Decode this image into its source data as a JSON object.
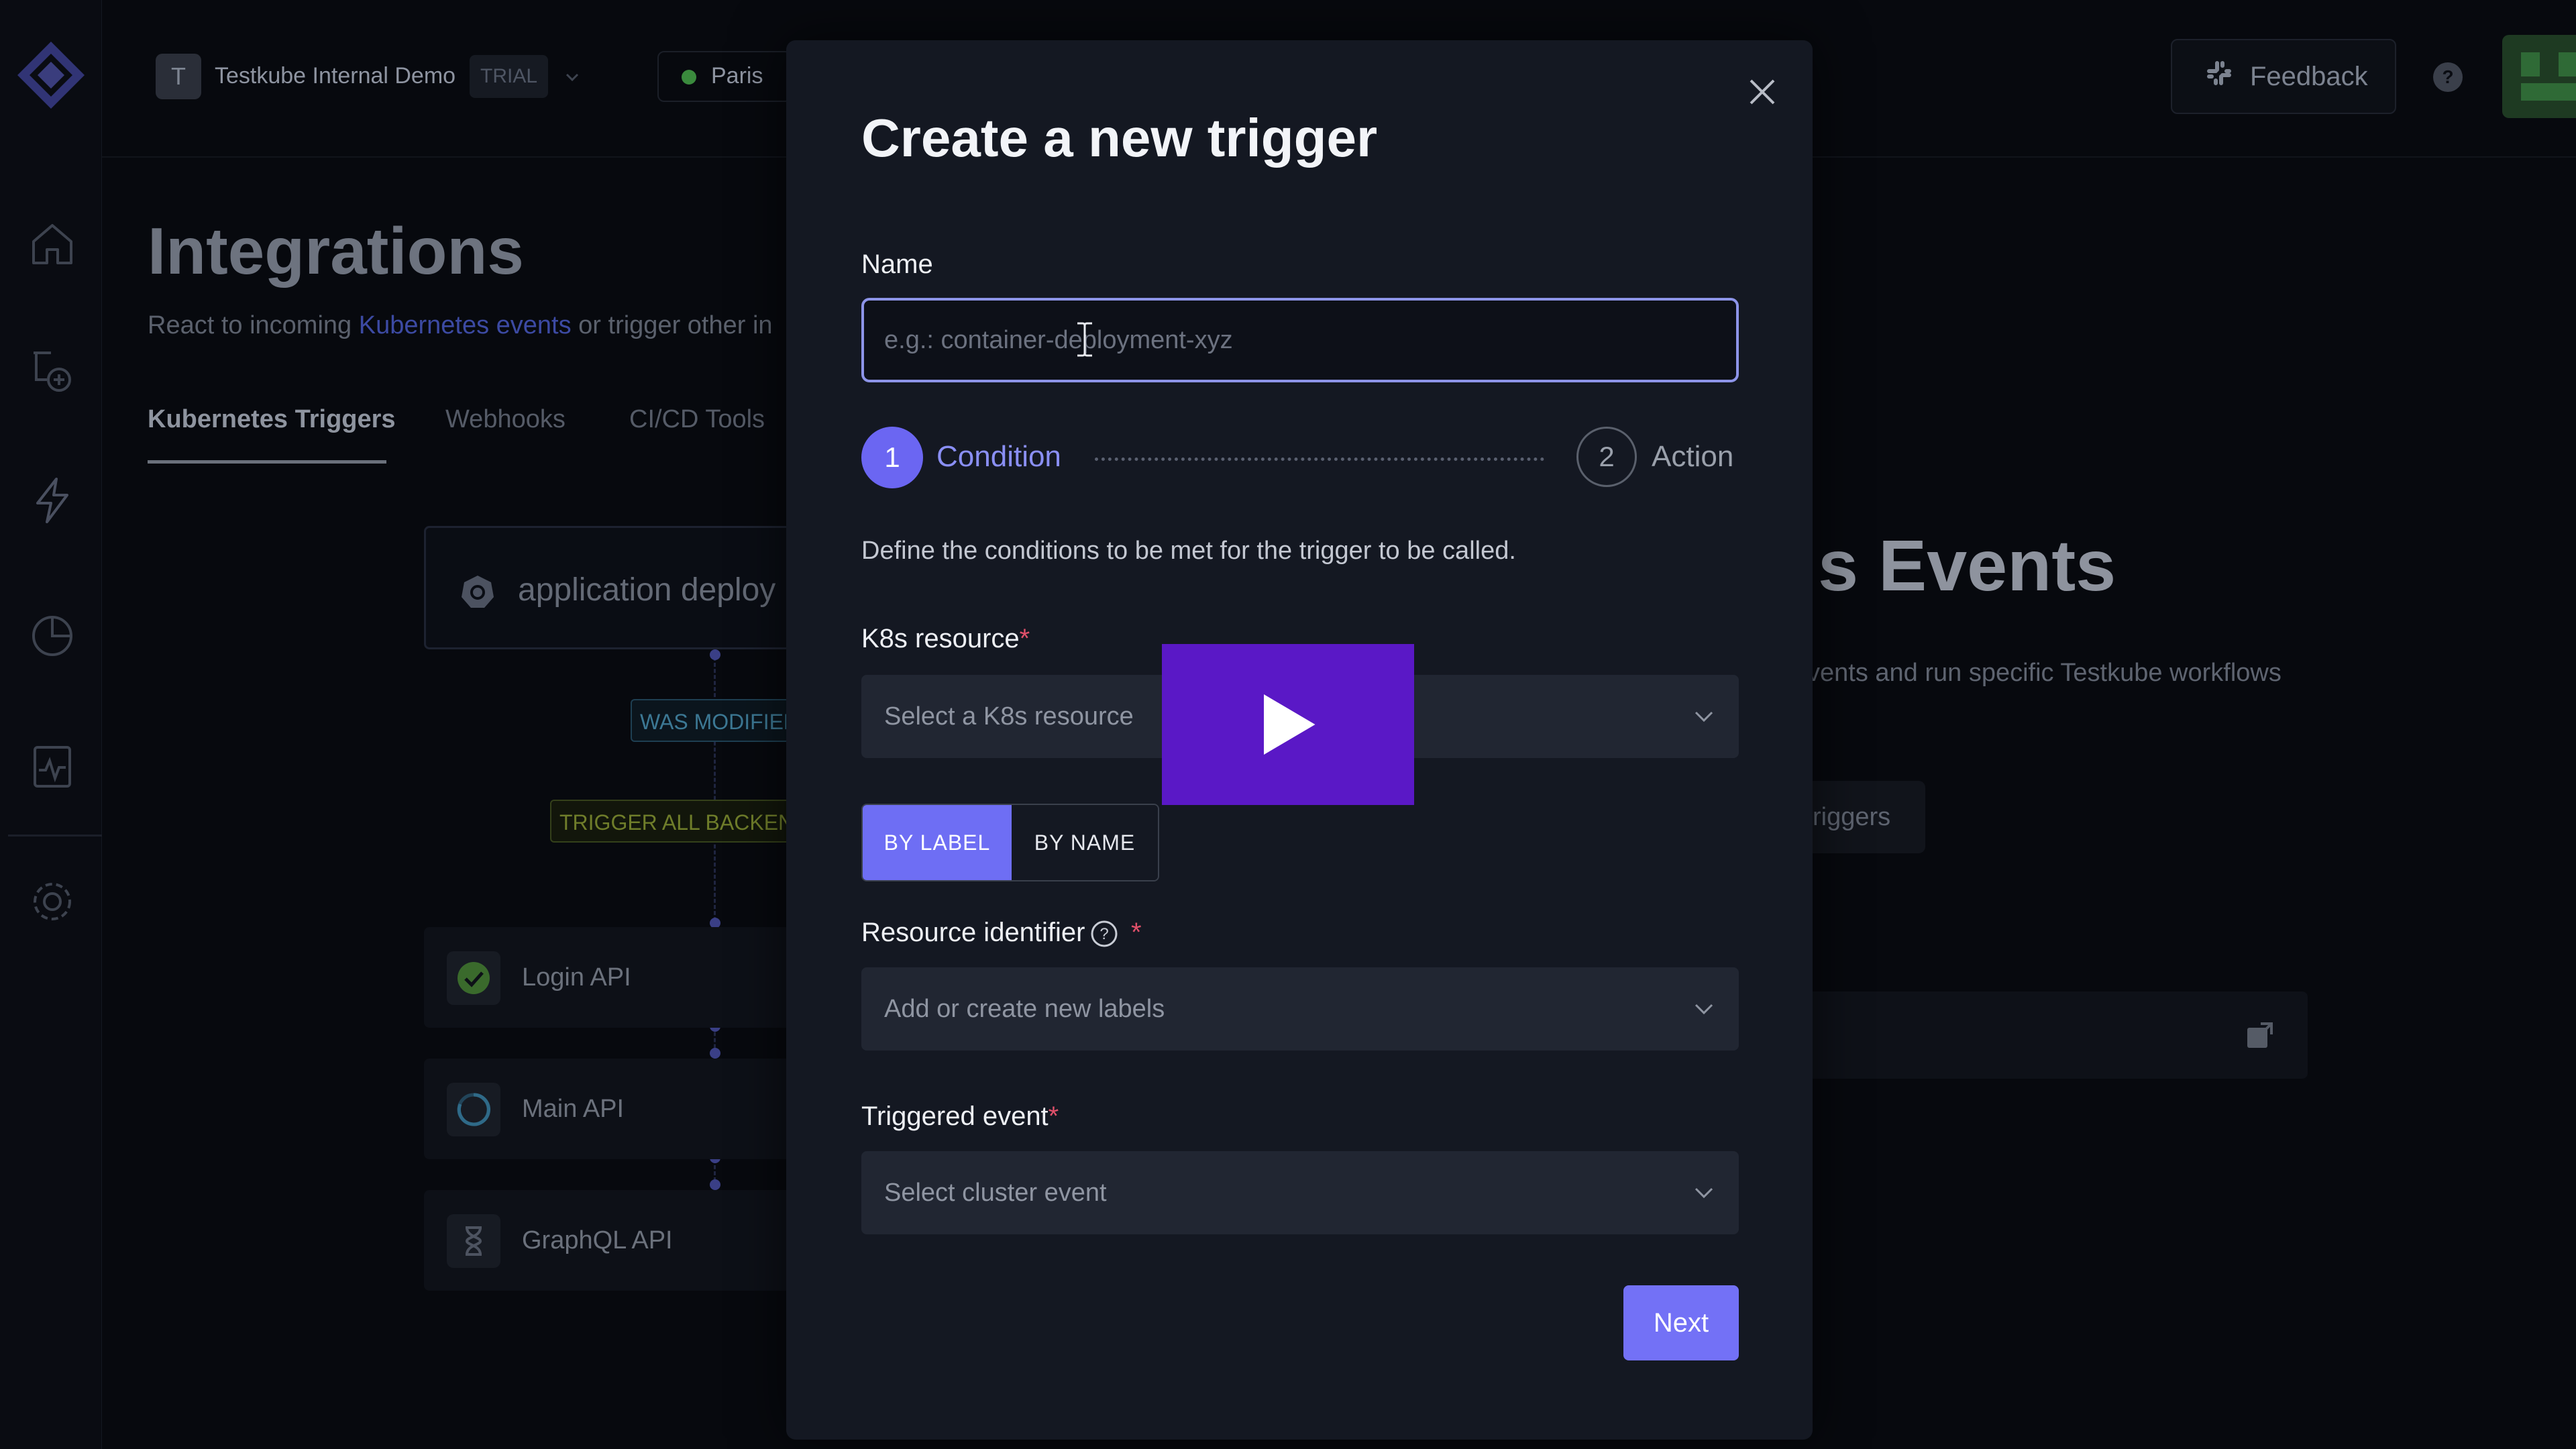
{
  "header": {
    "org_initial": "T",
    "org_name": "Testkube Internal Demo",
    "plan_badge": "TRIAL",
    "environment": "Paris",
    "feedback_label": "Feedback"
  },
  "sidebar": {
    "icons": [
      "home-icon",
      "add-workflow-icon",
      "lightning-icon",
      "analytics-icon",
      "status-icon",
      "settings-icon"
    ]
  },
  "page": {
    "title": "Integrations",
    "subtitle_prefix": "React to incoming ",
    "subtitle_link": "Kubernetes events",
    "subtitle_suffix": " or trigger other in",
    "tabs": [
      "Kubernetes Triggers",
      "Webhooks",
      "CI/CD Tools"
    ]
  },
  "trigger_flow": {
    "card_text": "application deploy",
    "condition_pill": "WAS MODIFIED",
    "action_pill": "TRIGGER ALL BACKEN",
    "apis": [
      {
        "name": "Login API",
        "status": "passed"
      },
      {
        "name": "Main API",
        "status": "running"
      },
      {
        "name": "GraphQL API",
        "status": "queued"
      }
    ]
  },
  "background_panel": {
    "title_fragment": "s Events",
    "subtitle_fragment": "vents and run specific Testkube workflows",
    "button_fragment": "riggers"
  },
  "modal": {
    "title": "Create a new trigger",
    "name_label": "Name",
    "name_placeholder": "e.g.: container-deployment-xyz",
    "name_value": "",
    "steps": [
      {
        "number": "1",
        "label": "Condition",
        "active": true
      },
      {
        "number": "2",
        "label": "Action",
        "active": false
      }
    ],
    "description": "Define the conditions to be met for the trigger to be called.",
    "k8s_resource_label": "K8s resource",
    "k8s_resource_placeholder": "Select a K8s resource",
    "mode_by_label": "BY LABEL",
    "mode_by_name": "BY NAME",
    "selected_mode": "BY LABEL",
    "resource_identifier_label": "Resource identifier",
    "resource_identifier_placeholder": "Add or create new labels",
    "triggered_event_label": "Triggered event",
    "triggered_event_placeholder": "Select cluster event",
    "required_marker": "*",
    "next_label": "Next"
  },
  "colors": {
    "accent": "#6b66f2",
    "modal_bg": "#141822",
    "page_bg": "#07090e",
    "video_overlay": "#5a18c6"
  }
}
